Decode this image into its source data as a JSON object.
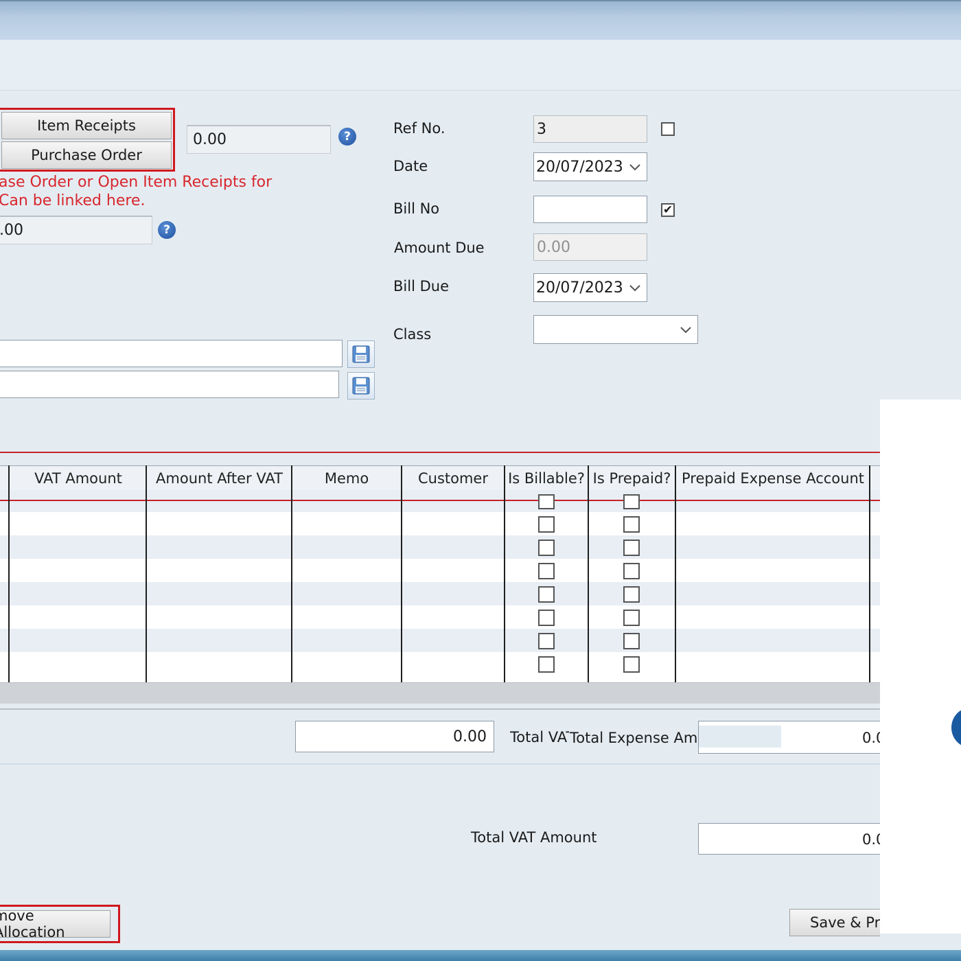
{
  "link_buttons": {
    "item_receipts": "Item Receipts",
    "purchase_order": "Purchase Order"
  },
  "linked_amount": "0.00",
  "link_note": {
    "line1": "ase Order or Open Item Receipts for",
    "line2": "Can be linked here."
  },
  "second_amount": ".00",
  "help_glyph": "?",
  "form": {
    "ref_no_label": "Ref No.",
    "ref_no_value": "3",
    "date_label": "Date",
    "date_value": "20/07/2023",
    "bill_no_label": "Bill No",
    "bill_no_value": "",
    "amount_due_label": "Amount Due",
    "amount_due_value": "0.00",
    "bill_due_label": "Bill Due",
    "bill_due_value": "20/07/2023",
    "class_label": "Class",
    "class_value": ""
  },
  "checkboxes": {
    "ref_no_checked": false,
    "bill_no_checked": true,
    "check_glyph": "✔"
  },
  "grid": {
    "columns": [
      "VAT Amount",
      "Amount After VAT",
      "Memo",
      "Customer",
      "Is Billable?",
      "Is Prepaid?",
      "Prepaid Expense Account"
    ]
  },
  "totals": {
    "vat_field_value": "0.00",
    "total_vat_short_label": "Total VAT",
    "total_expense_label": "Total Expense Amount",
    "total_expense_value": "0.0",
    "total_vat_amount_label": "Total VAT Amount",
    "total_vat_amount_value": "0.0"
  },
  "buttons": {
    "remove_allocation": "move Allocation",
    "save_print": "Save & Prin"
  },
  "colors": {
    "accent_red": "#d0181e",
    "note_red": "#d8262c",
    "help_blue": "#1d4f9e"
  },
  "icons": [
    "help-icon",
    "save-icon",
    "chevron-down-icon",
    "checkbox-icon"
  ]
}
